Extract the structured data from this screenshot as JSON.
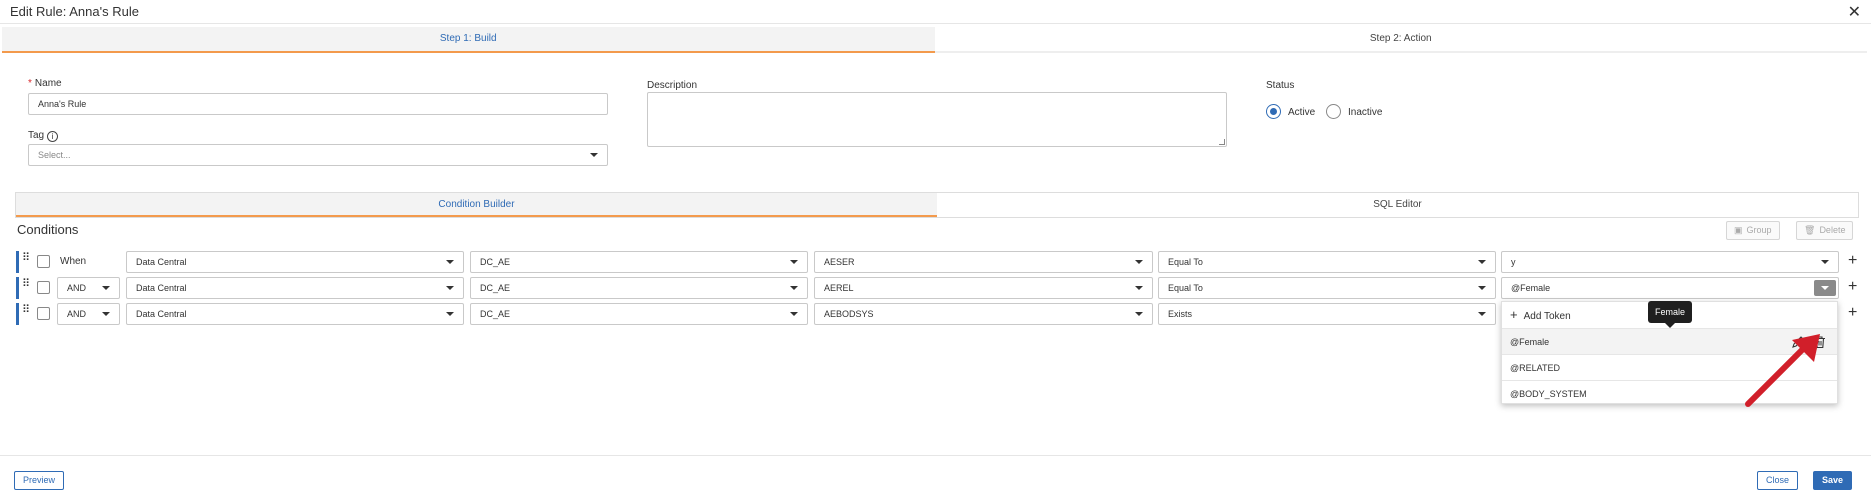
{
  "header": {
    "title": "Edit Rule: Anna's Rule"
  },
  "steps": [
    {
      "label": "Step 1: Build"
    },
    {
      "label": "Step 2: Action"
    }
  ],
  "form": {
    "name_label": "Name",
    "name_value": "Anna's Rule",
    "tag_label": "Tag",
    "tag_placeholder": "Select...",
    "description_label": "Description",
    "status_label": "Status",
    "status_options": [
      "Active",
      "Inactive"
    ],
    "status_selected": "Active"
  },
  "builder_tabs": [
    {
      "label": "Condition Builder"
    },
    {
      "label": "SQL Editor"
    }
  ],
  "conditions": {
    "title": "Conditions",
    "group_label": "Group",
    "delete_label": "Delete",
    "rows": [
      {
        "connector": "When",
        "source": "Data Central",
        "table": "DC_AE",
        "field": "AESER",
        "operator": "Equal To",
        "value": "y"
      },
      {
        "connector": "AND",
        "source": "Data Central",
        "table": "DC_AE",
        "field": "AEREL",
        "operator": "Equal To",
        "value": "@Female"
      },
      {
        "connector": "AND",
        "source": "Data Central",
        "table": "DC_AE",
        "field": "AEBODSYS",
        "operator": "Exists",
        "value": ""
      }
    ]
  },
  "token_dropdown": {
    "add_label": "Add Token",
    "items": [
      "@Female",
      "@RELATED",
      "@BODY_SYSTEM"
    ],
    "tooltip": "Female"
  },
  "footer": {
    "preview_label": "Preview",
    "close_label": "Close",
    "save_label": "Save"
  },
  "colors": {
    "accent": "#2f6bb5",
    "tab_underline": "#f39a4c",
    "annotation_arrow": "#d11f2a"
  }
}
